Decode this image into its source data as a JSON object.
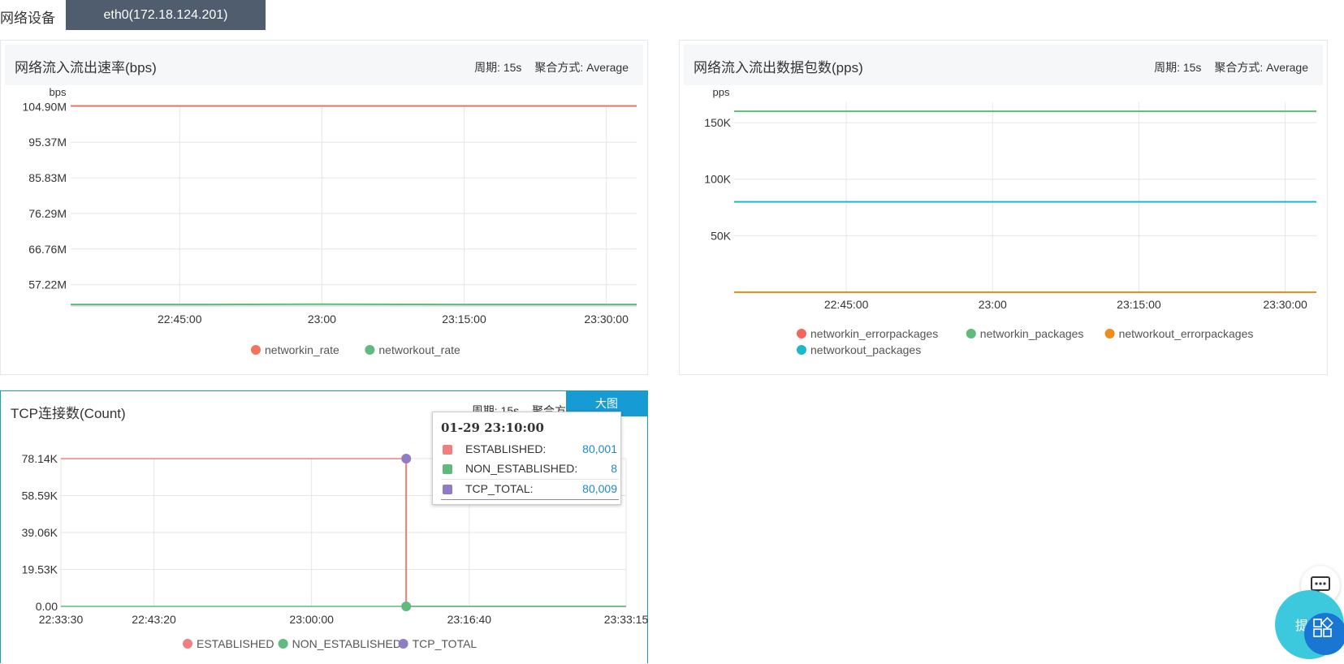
{
  "device": {
    "label": "网络设备",
    "tab": "eth0(172.18.124.201)"
  },
  "panels": {
    "bps": {
      "title": "网络流入流出速率(bps)",
      "period": "周期: 15s",
      "agg": "聚合方式: Average",
      "unit": "bps"
    },
    "pps": {
      "title": "网络流入流出数据包数(pps)",
      "period": "周期: 15s",
      "agg": "聚合方式: Average",
      "unit": "pps"
    },
    "tcp": {
      "title": "TCP连接数(Count)",
      "period": "周期: 15s",
      "agg": "聚合方",
      "big_button": "大图"
    }
  },
  "tooltip": {
    "time": "01-29 23:10:00",
    "rows": [
      {
        "name": "ESTABLISHED:",
        "value": "80,001",
        "color": "#f08080"
      },
      {
        "name": "NON_ESTABLISHED:",
        "value": "8",
        "color": "#5fba7d"
      },
      {
        "name": "TCP_TOTAL:",
        "value": "80,009",
        "color": "#8f7cc4"
      }
    ]
  },
  "floating": {
    "ask_label": "提问"
  },
  "chart_data": [
    {
      "type": "line",
      "title": "网络流入流出速率(bps)",
      "ylabel": "bps",
      "y_ticks": [
        "57.22M",
        "66.76M",
        "76.29M",
        "85.83M",
        "95.37M",
        "104.90M"
      ],
      "y_tick_values": [
        57.22,
        66.76,
        76.29,
        85.83,
        95.37,
        104.9
      ],
      "x_ticks": [
        "22:45:00",
        "23:00",
        "23:15:00",
        "23:30:00"
      ],
      "x_tick_minutes": [
        45,
        60,
        75,
        90
      ],
      "x_range_minutes": [
        33.5,
        93.2
      ],
      "ylim_M": [
        51.5,
        105.2
      ],
      "series": [
        {
          "name": "networkin_rate",
          "color": "#f4745b",
          "x_minutes": [
            33.5,
            45,
            60,
            75,
            93.2
          ],
          "values_M": [
            105.1,
            105.1,
            105.1,
            105.1,
            105.1
          ]
        },
        {
          "name": "networkout_rate",
          "color": "#5fba7d",
          "x_minutes": [
            33.5,
            45,
            60,
            75,
            93.2
          ],
          "values_M": [
            51.9,
            51.9,
            52.0,
            51.9,
            51.9
          ]
        }
      ],
      "legend": "bottom"
    },
    {
      "type": "line",
      "title": "网络流入流出数据包数(pps)",
      "ylabel": "pps",
      "y_ticks": [
        "50K",
        "100K",
        "150K"
      ],
      "y_tick_values": [
        50000,
        100000,
        150000
      ],
      "x_ticks": [
        "22:45:00",
        "23:00",
        "23:15:00",
        "23:30:00"
      ],
      "x_tick_minutes": [
        45,
        60,
        75,
        90
      ],
      "x_range_minutes": [
        33.5,
        93.2
      ],
      "ylim": [
        0,
        168000
      ],
      "series": [
        {
          "name": "networkin_errorpackages",
          "color": "#f4665b",
          "x_minutes": [
            33.5,
            93.2
          ],
          "values": [
            0,
            0
          ]
        },
        {
          "name": "networkin_packages",
          "color": "#5fba7d",
          "x_minutes": [
            33.5,
            93.2
          ],
          "values": [
            160000,
            160000
          ]
        },
        {
          "name": "networkout_errorpackages",
          "color": "#f08c1c",
          "x_minutes": [
            33.5,
            93.2
          ],
          "values": [
            0,
            0
          ]
        },
        {
          "name": "networkout_packages",
          "color": "#1cb8d0",
          "x_minutes": [
            33.5,
            93.2
          ],
          "values": [
            80000,
            80000
          ]
        }
      ],
      "legend": "bottom"
    },
    {
      "type": "line",
      "title": "TCP连接数(Count)",
      "y_ticks": [
        "0.00",
        "19.53K",
        "39.06K",
        "58.59K",
        "78.14K"
      ],
      "y_tick_values": [
        0,
        19530,
        39060,
        58590,
        78140
      ],
      "x_ticks": [
        "22:33:30",
        "22:43:20",
        "23:00:00",
        "23:16:40",
        "23:33:15"
      ],
      "x_tick_seconds": [
        2010,
        2600,
        3600,
        4600,
        5595
      ],
      "x_range_seconds": [
        2010,
        5595
      ],
      "ylim": [
        0,
        78140
      ],
      "series": [
        {
          "name": "ESTABLISHED",
          "color": "#f08080",
          "x_seconds": [
            2010,
            4200,
            4200,
            5595
          ],
          "values": [
            78140,
            78140,
            0,
            0
          ]
        },
        {
          "name": "NON_ESTABLISHED",
          "color": "#5fba7d",
          "x_seconds": [
            2010,
            5595
          ],
          "values": [
            0,
            0
          ]
        },
        {
          "name": "TCP_TOTAL",
          "color": "#8f7cc4",
          "x_seconds": [
            4200
          ],
          "values": [
            78140
          ]
        }
      ],
      "crosshair_seconds": 4200,
      "legend": "bottom"
    }
  ]
}
